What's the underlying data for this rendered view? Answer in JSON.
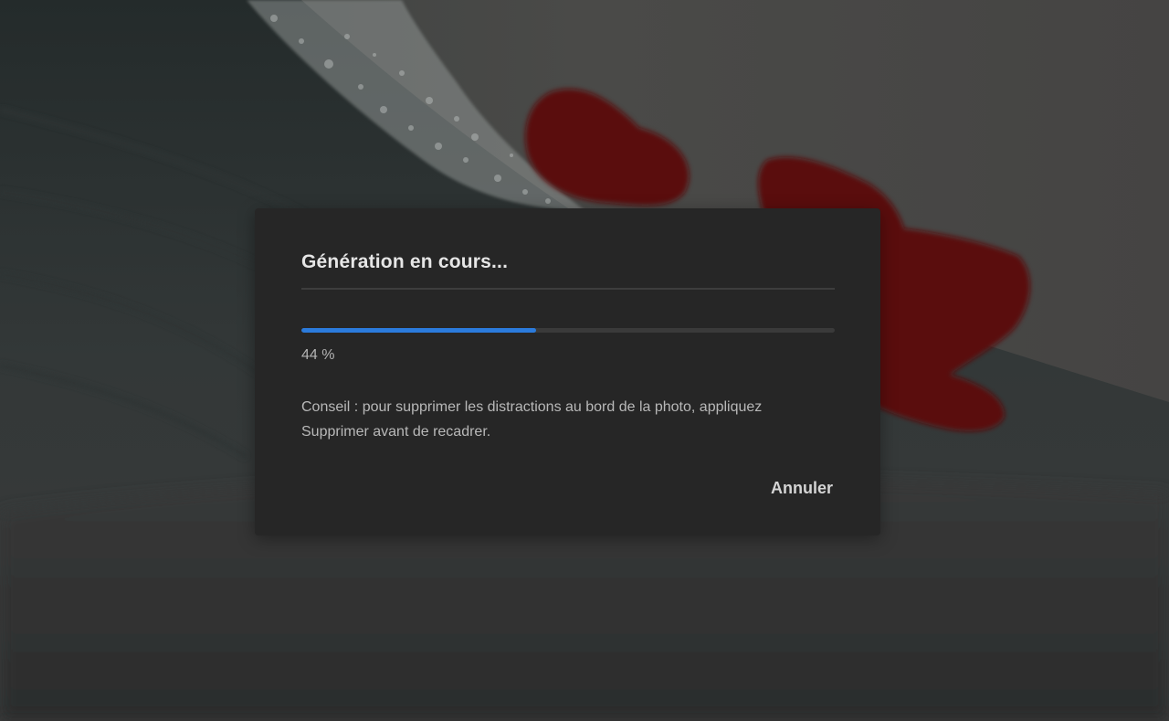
{
  "dialog": {
    "title": "Génération en cours...",
    "progress": {
      "fraction": 0.44,
      "label": "44 %",
      "accent_color": "#2b7bdc"
    },
    "tip_lines": [
      "Conseil : pour supprimer les distractions au bord de la photo, appliquez",
      "Supprimer avant de recadrer."
    ],
    "cancel_label": "Annuler"
  },
  "background": {
    "subject": "wave",
    "mask_color": "#5a0d0d"
  }
}
